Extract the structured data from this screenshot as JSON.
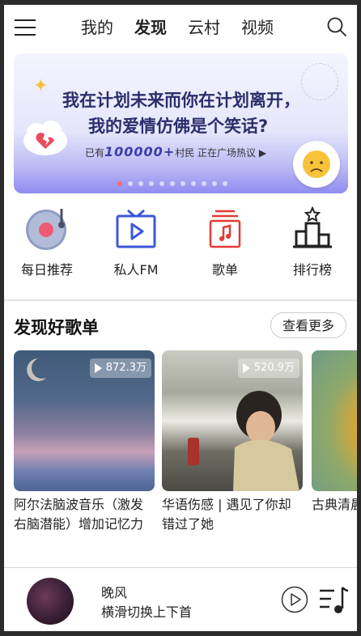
{
  "header": {
    "tabs": [
      "我的",
      "发现",
      "云村",
      "视频"
    ],
    "active_tab": "发现"
  },
  "banner": {
    "line1": "我在计划未来而你在计划离开，",
    "line2": "我的爱情仿佛是个笑话?",
    "sub_prefix": "已有",
    "sub_count": "100000+",
    "sub_suffix": "村民  正在广场热议 ▶",
    "page_count": 11,
    "active_page": 1
  },
  "categories": [
    {
      "label": "每日推荐",
      "icon": "daily-recommend-icon"
    },
    {
      "label": "私人FM",
      "icon": "radio-tv-icon"
    },
    {
      "label": "歌单",
      "icon": "playlist-icon"
    },
    {
      "label": "排行榜",
      "icon": "ranking-icon"
    }
  ],
  "section": {
    "title": "发现好歌单",
    "more_label": "查看更多"
  },
  "playlists": [
    {
      "title": "阿尔法脑波音乐（激发右脑潜能）增加记忆力",
      "play_count": "872.3万"
    },
    {
      "title": "华语伤感 | 遇见了你却错过了她",
      "play_count": "520.9万"
    },
    {
      "title": "古典清晨阳光住着巴",
      "play_count": ""
    }
  ],
  "player": {
    "song": "晚风",
    "hint": "横滑切换上下首"
  },
  "colors": {
    "accent": "#e53935",
    "nav_icon_blue": "#3b57d9",
    "text": "#222222"
  }
}
